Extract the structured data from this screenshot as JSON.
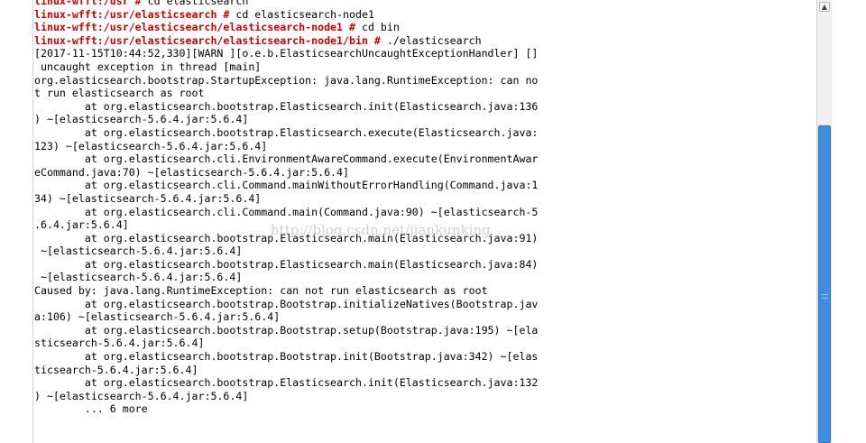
{
  "terminal": {
    "lines": [
      {
        "prompt": "linux-wfft:/usr #",
        "cmd": " cd elasticsearch"
      },
      {
        "prompt": "linux-wfft:/usr/elasticsearch #",
        "cmd": " cd elasticsearch-node1"
      },
      {
        "prompt": "linux-wfft:/usr/elasticsearch/elasticsearch-node1 #",
        "cmd": " cd bin"
      },
      {
        "prompt": "linux-wfft:/usr/elasticsearch/elasticsearch-node1/bin #",
        "cmd": " ./elasticsearch"
      },
      {
        "text": "[2017-11-15T10:44:52,330][WARN ][o.e.b.ElasticsearchUncaughtExceptionHandler] []"
      },
      {
        "text": " uncaught exception in thread [main]"
      },
      {
        "text": "org.elasticsearch.bootstrap.StartupException: java.lang.RuntimeException: can no"
      },
      {
        "text": "t run elasticsearch as root"
      },
      {
        "text": "        at org.elasticsearch.bootstrap.Elasticsearch.init(Elasticsearch.java:136"
      },
      {
        "text": ") ~[elasticsearch-5.6.4.jar:5.6.4]"
      },
      {
        "text": "        at org.elasticsearch.bootstrap.Elasticsearch.execute(Elasticsearch.java:"
      },
      {
        "text": "123) ~[elasticsearch-5.6.4.jar:5.6.4]"
      },
      {
        "text": "        at org.elasticsearch.cli.EnvironmentAwareCommand.execute(EnvironmentAwar"
      },
      {
        "text": "eCommand.java:70) ~[elasticsearch-5.6.4.jar:5.6.4]"
      },
      {
        "text": "        at org.elasticsearch.cli.Command.mainWithoutErrorHandling(Command.java:1"
      },
      {
        "text": "34) ~[elasticsearch-5.6.4.jar:5.6.4]"
      },
      {
        "text": "        at org.elasticsearch.cli.Command.main(Command.java:90) ~[elasticsearch-5"
      },
      {
        "text": ".6.4.jar:5.6.4]"
      },
      {
        "text": "        at org.elasticsearch.bootstrap.Elasticsearch.main(Elasticsearch.java:91)"
      },
      {
        "text": " ~[elasticsearch-5.6.4.jar:5.6.4]"
      },
      {
        "text": "        at org.elasticsearch.bootstrap.Elasticsearch.main(Elasticsearch.java:84)"
      },
      {
        "text": " ~[elasticsearch-5.6.4.jar:5.6.4]"
      },
      {
        "text": "Caused by: java.lang.RuntimeException: can not run elasticsearch as root"
      },
      {
        "text": "        at org.elasticsearch.bootstrap.Bootstrap.initializeNatives(Bootstrap.jav"
      },
      {
        "text": "a:106) ~[elasticsearch-5.6.4.jar:5.6.4]"
      },
      {
        "text": "        at org.elasticsearch.bootstrap.Bootstrap.setup(Bootstrap.java:195) ~[ela"
      },
      {
        "text": "sticsearch-5.6.4.jar:5.6.4]"
      },
      {
        "text": "        at org.elasticsearch.bootstrap.Bootstrap.init(Bootstrap.java:342) ~[elas"
      },
      {
        "text": "ticsearch-5.6.4.jar:5.6.4]"
      },
      {
        "text": "        at org.elasticsearch.bootstrap.Elasticsearch.init(Elasticsearch.java:132"
      },
      {
        "text": ") ~[elasticsearch-5.6.4.jar:5.6.4]"
      },
      {
        "text": "        ... 6 more"
      }
    ]
  },
  "watermark": "http://blog.csdn.net/jiankunking",
  "scrollbar": {
    "up_arrow_icon": "chevron-up-icon",
    "position_fraction": 0.28,
    "visible_fraction": 0.72
  },
  "colors": {
    "prompt": "#d40000",
    "text": "#000000",
    "background": "#ffffff",
    "scroll_thumb": "#3d8ee0"
  }
}
